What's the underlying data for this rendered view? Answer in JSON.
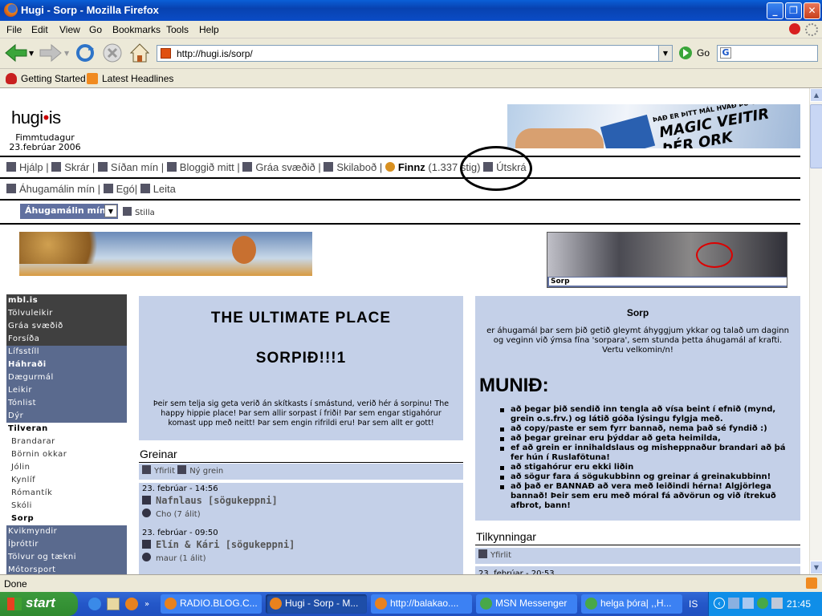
{
  "window": {
    "title": "Hugi - Sorp - Mozilla Firefox"
  },
  "menu": [
    "File",
    "Edit",
    "View",
    "Go",
    "Bookmarks",
    "Tools",
    "Help"
  ],
  "nav": {
    "url": "http://hugi.is/sorp/",
    "go_label": "Go"
  },
  "bookmarks": [
    "Getting Started",
    "Latest Headlines"
  ],
  "page": {
    "logo_a": "hugi",
    "logo_dot": "•",
    "logo_b": "is",
    "weekday": "Fimmtudagur",
    "date": "23.febrúar 2006",
    "ad_text": "MAGIC VEITIR ÞÉR ORK",
    "ad_small": "ÞAÐ ER ÞITT MÁL HVAÐ ÞÚ GERIR",
    "nav1": [
      "Hjálp",
      "Skrár",
      "Síðan mín",
      "Bloggið mitt",
      "Gráa svæðið",
      "Skilaboð"
    ],
    "user": "Finnz",
    "points": "(1.337 stig)",
    "logout": "Útskrá",
    "nav2": [
      "Áhugamálin mín",
      "Egó",
      "Leita"
    ],
    "select_value": "Áhugamálin mín",
    "stilla": "Stilla",
    "ad3_caption": "Sorp",
    "sidebar_dark": [
      "mbl.is",
      "Tölvuleikir",
      "Gráa svæðið",
      "Forsíða"
    ],
    "sidebar_blue1": [
      "Lífsstíll",
      "Háhraði",
      "Dægurmál",
      "Leikir",
      "Tónlist",
      "Dýr"
    ],
    "sidebar_head": "Tilveran",
    "sidebar_sub": [
      "Brandarar",
      "Börnin okkar",
      "Jólin",
      "Kynlíf",
      "Rómantík",
      "Skóli",
      "Sorp"
    ],
    "sidebar_blue2": [
      "Kvikmyndir",
      "Íþróttir",
      "Tölvur og tækni",
      "Mótorsport"
    ],
    "welcome_title1": "THE ULTIMATE PLACE",
    "welcome_title2": "SORPIÐ!!!1",
    "welcome_text": "Þeir sem telja sig geta verið án skítkasts í smástund, verið hér á sorpinu! The happy hippie place! Þar sem allir sorpast í friði! Þar sem engar stigahórur komast upp með neitt! Þar sem engin rifrildi eru! Þar sem allt er gott!",
    "greinar_title": "Greinar",
    "greinar_links": [
      "Yfirlit",
      "Ný grein"
    ],
    "articles": [
      {
        "date": "23. febrúar - 14:56",
        "title": "Nafnlaus [sögukeppni]",
        "author": "Cho",
        "comments": "(7 álit)"
      },
      {
        "date": "23. febrúar - 09:50",
        "title": "Elín & Kári [sögukeppni]",
        "author": "maur",
        "comments": "(1 álit)"
      }
    ],
    "sorp_title": "Sorp",
    "sorp_intro": "er áhugamál þar sem þið getið gleymt áhyggjum ykkar og talað um daginn og veginn við ýmsa fína 'sorpara', sem stunda þetta áhugamál af krafti. Vertu velkomin/n!",
    "munid": "MUNIÐ:",
    "rules": [
      "að þegar þið sendið inn tengla að vísa beint í efnið (mynd, grein o.s.frv.) og látið góða lýsingu fylgja með.",
      "að copy/paste er sem fyrr bannað, nema það sé fyndið :)",
      "að þegar greinar eru þýddar að geta heimilda,",
      "ef að grein er innihaldslaus og misheppnaður brandari að þá fer hún í Ruslafötuna!",
      "að stigahórur eru ekki liðin",
      "að sögur fara á sögukubbinn og greinar á greinakubbinn!",
      "að það er BANNAÐ að vera með leiðindi hérna! Algjörlega bannað! Þeir sem eru með móral fá aðvörun og við ítrekuð afbrot, bann!"
    ],
    "tilk_title": "Tilkynningar",
    "tilk_link": "Yfirlit",
    "tilk_date": "23. febrúar - 20:53"
  },
  "status": "Done",
  "taskbar": {
    "start": "start",
    "items": [
      "RADIO.BLOG.C...",
      "Hugi - Sorp - M...",
      "http://balakao....",
      "MSN Messenger",
      "helga þóra| ,,H..."
    ],
    "lang": "IS",
    "clock": "21:45"
  }
}
